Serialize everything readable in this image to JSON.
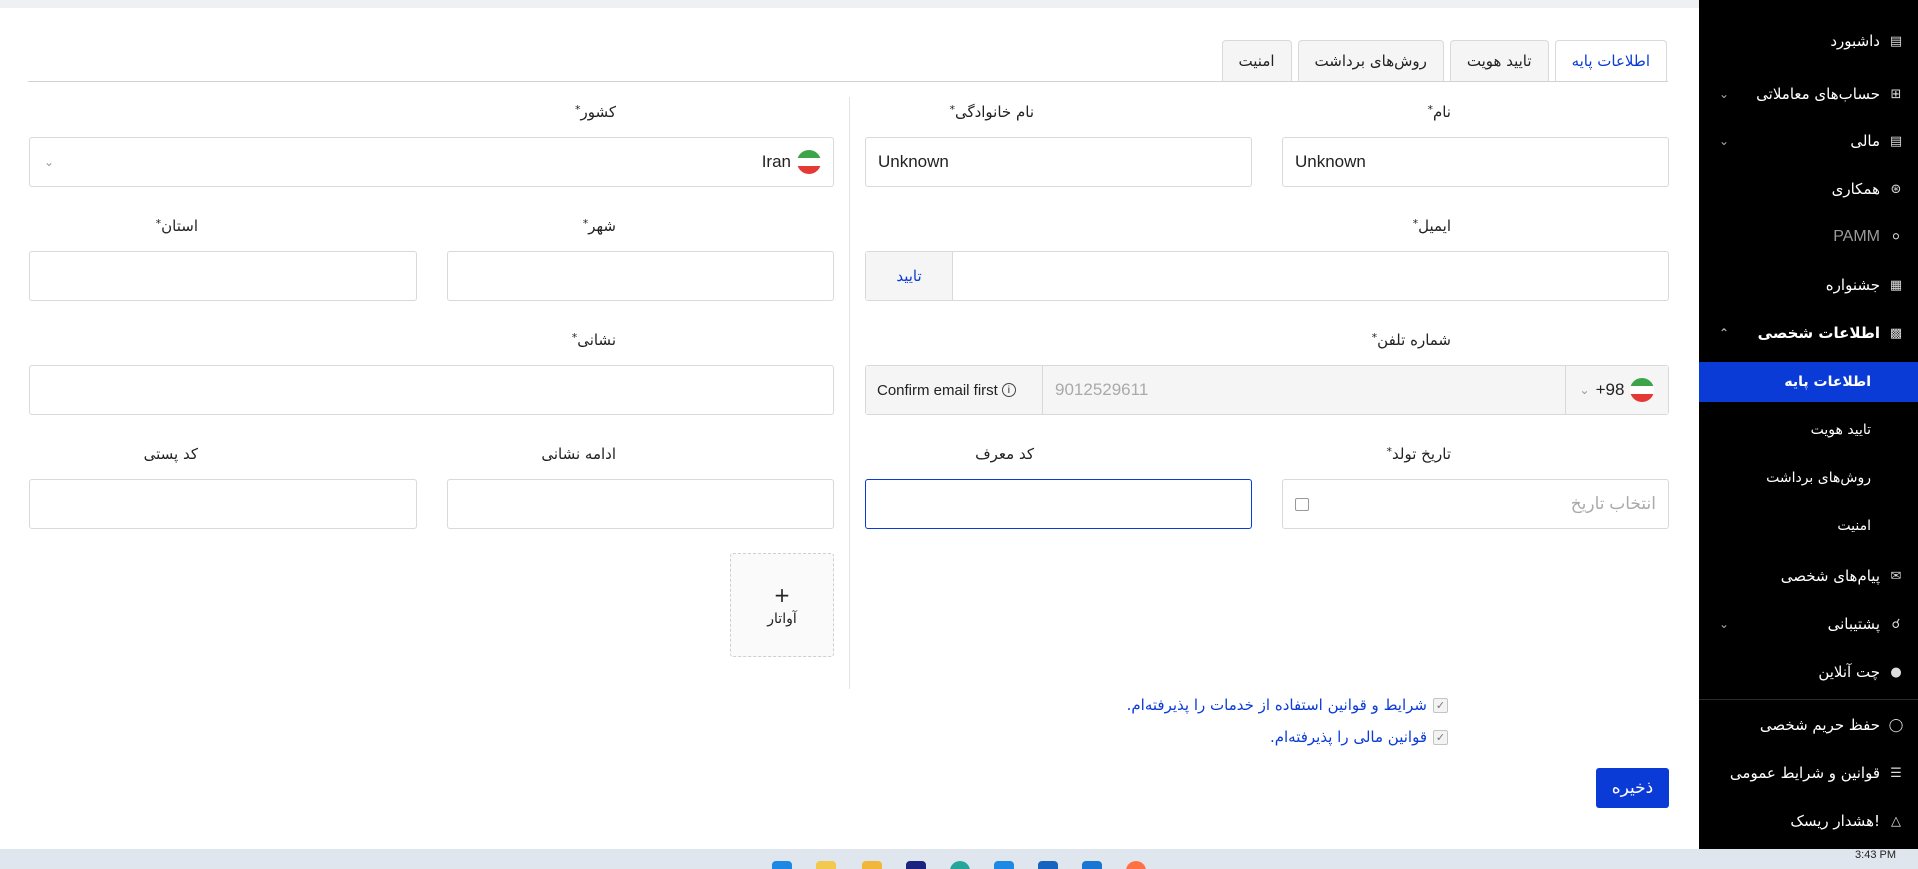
{
  "tabs": [
    {
      "label": "اطلاعات پایه",
      "active": true
    },
    {
      "label": "تایید هویت",
      "active": false
    },
    {
      "label": "روش‌های برداشت",
      "active": false
    },
    {
      "label": "امنیت",
      "active": false
    }
  ],
  "form": {
    "first_name": {
      "label": "نام",
      "value": "Unknown"
    },
    "last_name": {
      "label": "نام خانوادگی",
      "value": "Unknown"
    },
    "country": {
      "label": "کشور",
      "value": "Iran"
    },
    "email": {
      "label": "ایمیل",
      "value": "",
      "confirm_label": "تایید"
    },
    "city": {
      "label": "شهر",
      "value": ""
    },
    "province": {
      "label": "استان",
      "value": ""
    },
    "phone": {
      "label": "شماره تلفن",
      "code": "+98",
      "value": "9012529611",
      "hint": "Confirm email first"
    },
    "address": {
      "label": "نشانی",
      "value": ""
    },
    "birth_date": {
      "label": "تاریخ تولد",
      "placeholder": "انتخاب تاریخ"
    },
    "referral_code": {
      "label": "کد معرف",
      "value": ""
    },
    "address_cont": {
      "label": "ادامه نشانی",
      "value": ""
    },
    "postal_code": {
      "label": "کد پستی",
      "value": ""
    },
    "avatar": {
      "label": "آواتار",
      "plus": "+"
    },
    "required_mark": "*"
  },
  "agreements": [
    {
      "label": "شرایط و قوانین استفاده از خدمات را پذیرفته‌ام.",
      "checked": true
    },
    {
      "label": "قوانین مالی را پذیرفته‌ام.",
      "checked": true
    }
  ],
  "save_label": "ذخیره",
  "sidebar": {
    "items": [
      {
        "label": "داشبورد",
        "icon": "chart-icon"
      },
      {
        "label": "حساب‌های معاملاتی",
        "icon": "grid-icon"
      },
      {
        "label": "مالی",
        "icon": "wallet-icon"
      },
      {
        "label": "همکاری",
        "icon": "partnership-icon"
      },
      {
        "label": "PAMM",
        "icon": "pamm-icon"
      },
      {
        "label": "جشنواره",
        "icon": "gift-icon"
      },
      {
        "label": "اطلاعات شخصی",
        "icon": "id-card-icon"
      }
    ],
    "sub_items": [
      {
        "label": "اطلاعات پایه",
        "active": true
      },
      {
        "label": "تایید هویت",
        "active": false
      },
      {
        "label": "روش‌های برداشت",
        "active": false
      },
      {
        "label": "امنیت",
        "active": false
      }
    ],
    "items2": [
      {
        "label": "پیام‌های شخصی",
        "icon": "mail-icon"
      },
      {
        "label": "پشتیبانی",
        "icon": "headset-icon"
      },
      {
        "label": "چت آنلاین",
        "icon": "chat-icon"
      },
      {
        "label": "حفظ حریم شخصی",
        "icon": "shield-icon"
      },
      {
        "label": "قوانین و شرایط عمومی",
        "icon": "list-icon"
      },
      {
        "label": "هشدار ریسک!",
        "icon": "warning-icon"
      }
    ]
  },
  "taskbar": {
    "time": "3:43 PM"
  },
  "colors": {
    "accent": "#0a3bd6",
    "sidebar_bg": "#000000"
  }
}
